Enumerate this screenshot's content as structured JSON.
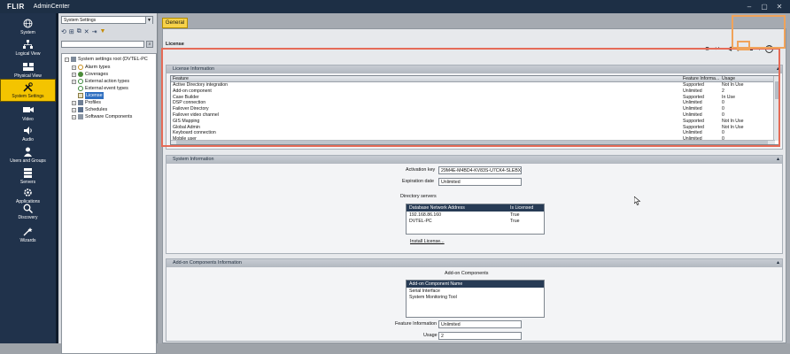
{
  "titlebar": {
    "logo": "FLIR",
    "app": "AdminCenter",
    "controls": [
      "–",
      "▢",
      "✕"
    ]
  },
  "nav": {
    "items": [
      {
        "label": "System",
        "icon": "globe-icon",
        "active": false
      },
      {
        "label": "Logical View",
        "icon": "tree-icon",
        "active": false
      },
      {
        "label": "Physical View",
        "icon": "server-rack-icon",
        "active": false
      },
      {
        "label": "System Settings",
        "icon": "tools-icon",
        "active": true
      },
      {
        "label": "Video",
        "icon": "camera-icon",
        "active": false
      },
      {
        "label": "Audio",
        "icon": "speaker-icon",
        "active": false
      },
      {
        "label": "Users and Groups",
        "icon": "users-icon",
        "active": false
      },
      {
        "label": "Servers",
        "icon": "server-icon",
        "active": false
      },
      {
        "label": "Applications",
        "icon": "gear-icon",
        "active": false
      },
      {
        "label": "Discovery",
        "icon": "magnifier-icon",
        "active": false
      },
      {
        "label": "Wizards",
        "icon": "wand-icon",
        "active": false
      }
    ]
  },
  "tree": {
    "combo_value": "System Settings",
    "root": "System settings root (DVTEL-PC",
    "items": [
      {
        "label": "Alarm types",
        "expander": "+"
      },
      {
        "label": "Coverages",
        "expander": "+"
      },
      {
        "label": "External action types",
        "expander": "+"
      },
      {
        "label": "External event types",
        "expander": ""
      },
      {
        "label": "License",
        "expander": "",
        "selected": true
      },
      {
        "label": "Profiles",
        "expander": "+"
      },
      {
        "label": "Schedules",
        "expander": "+"
      },
      {
        "label": "Software Components",
        "expander": "+"
      }
    ]
  },
  "main": {
    "tab": "General",
    "subtitle": "License",
    "toolbar": [
      "■",
      "↩",
      "◀",
      "▶",
      "▬",
      "▾",
      "?"
    ]
  },
  "license_panel": {
    "title": "License Information",
    "columns": [
      "Feature",
      "Feature Informa...",
      "Usage"
    ],
    "rows": [
      [
        "Active Directory integration",
        "Supported",
        "Not In Use"
      ],
      [
        "Add-on component",
        "Unlimited",
        "2"
      ],
      [
        "Case Builder",
        "Supported",
        "In Use"
      ],
      [
        "DSP connection",
        "Unlimited",
        "0"
      ],
      [
        "Failover Directory",
        "Unlimited",
        "0"
      ],
      [
        "Failover video channel",
        "Unlimited",
        "0"
      ],
      [
        "GIS Mapping",
        "Supported",
        "Not In Use"
      ],
      [
        "Global Admin",
        "Supported",
        "Not In Use"
      ],
      [
        "Keyboard connection",
        "Unlimited",
        "0"
      ],
      [
        "Mobile user",
        "Unlimited",
        "0"
      ]
    ]
  },
  "system_panel": {
    "title": "System Information",
    "activation_label": "Activation key",
    "activation_value": "29M4E-M4BD4-KV83S-U7CK4-SLEBX",
    "expiration_label": "Expiration date",
    "expiration_value": "Unlimited",
    "directory_label": "Directory servers",
    "dir_columns": [
      "Database Network Address",
      "Is Licensed"
    ],
    "dir_rows": [
      [
        "192.168.86.160",
        "True"
      ],
      [
        "DVTEL-PC",
        "True"
      ]
    ],
    "install_label": "Install License..."
  },
  "addon_panel": {
    "title": "Add-on Components Information",
    "components_label": "Add-on Components",
    "column": "Add-on Component Name",
    "rows": [
      "Serial Interface",
      "System Monitoring Tool"
    ],
    "feature_label": "Feature Information",
    "feature_value": "Unlimited",
    "usage_label": "Usage",
    "usage_value": "2"
  }
}
